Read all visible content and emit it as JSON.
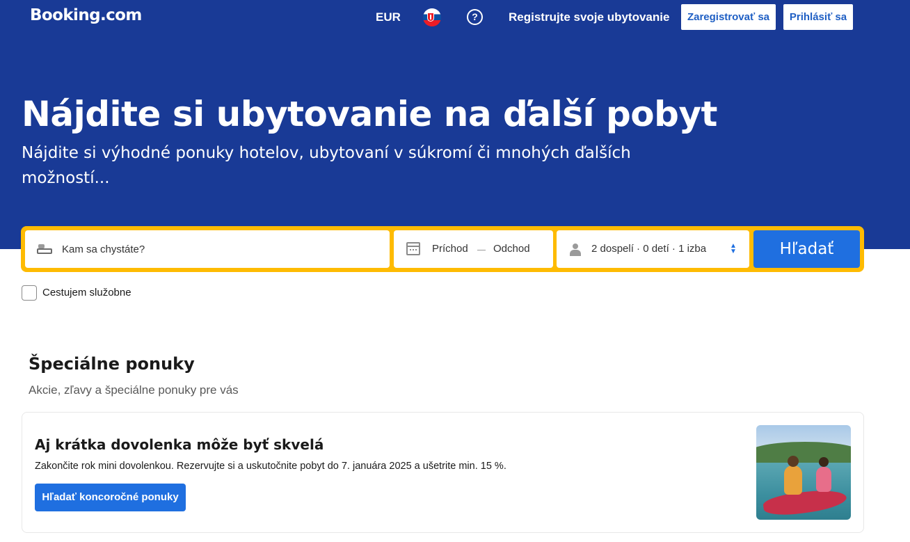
{
  "header": {
    "logo": "Booking.com",
    "currency": "EUR",
    "flag_icon": "slovakia-flag-icon",
    "help_icon": "question-circle-icon",
    "list_property": "Registrujte svoje ubytovanie",
    "register": "Zaregistrovať sa",
    "sign_in": "Prihlásiť sa"
  },
  "hero": {
    "title": "Nájdite si ubytovanie na ďalší pobyt",
    "subtitle": "Nájdite si výhodné ponuky hotelov, ubytovaní v súkromí či mnohých ďalších možností..."
  },
  "search": {
    "destination_placeholder": "Kam sa chystáte?",
    "checkin": "Príchod",
    "date_separator": "—",
    "checkout": "Odchod",
    "guests": "2 dospelí · 0 detí · 1 izba",
    "submit": "Hľadať"
  },
  "business_travel": {
    "label": "Cestujem služobne",
    "checked": false
  },
  "offers": {
    "title": "Špeciálne ponuky",
    "subtitle": "Akcie, zľavy a špeciálne ponuky pre vás",
    "card": {
      "title": "Aj krátka dovolenka môže byť skvelá",
      "text": "Zakončite rok mini dovolenkou. Rezervujte si a uskutočnite pobyt do 7. januára 2025 a ušetrite min. 15 %.",
      "button": "Hľadať koncoročné ponuky"
    }
  },
  "colors": {
    "brand_blue": "#193a96",
    "action_blue": "#1f6fe0",
    "search_border": "#febb02"
  }
}
